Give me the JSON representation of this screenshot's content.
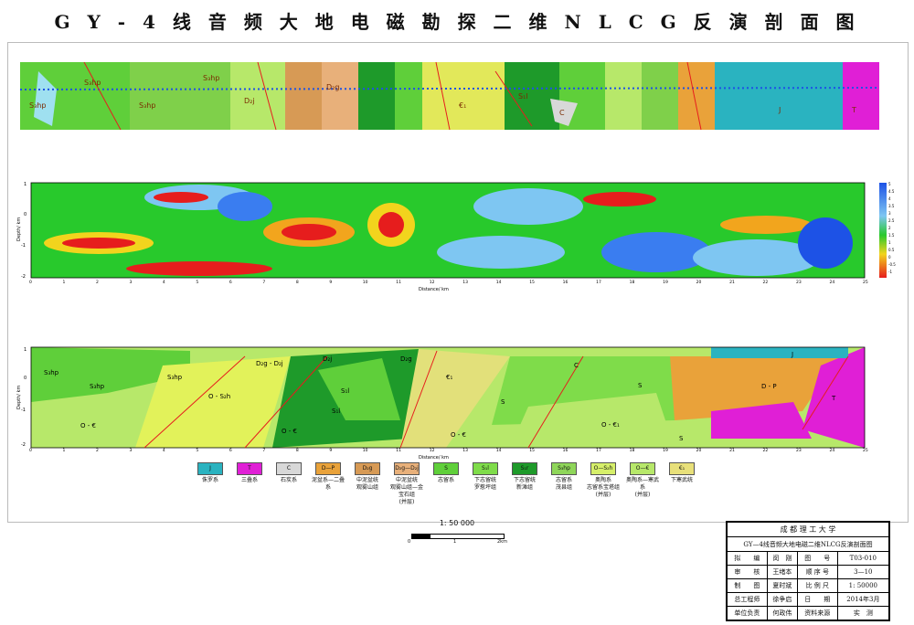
{
  "title": "G Y - 4 线 音 频 大 地 电 磁 勘 探 二 维 N L C G 反 演 剖 面 图",
  "colors": {
    "geo_green": "#5fcf3a",
    "geo_light": "#b7e86a",
    "geo_yellow": "#e2f25a",
    "geo_dark": "#1e9a2a",
    "geo_orange": "#e9a23a",
    "geo_magenta": "#e01fd6",
    "geo_teal": "#2ab3c0",
    "rho_red": "#e61d1d",
    "rho_blue": "#1d52e6"
  },
  "top_map": {
    "unit_labels": [
      "S₃hp",
      "S₃hp",
      "S₃hp",
      "S₃hp",
      "D₂j",
      "D₂g",
      "C",
      "€₁",
      "S₁l",
      "J",
      "T"
    ]
  },
  "inversion": {
    "y_ticks": [
      "1",
      "0",
      "-1",
      "-2"
    ],
    "y_label": "Depth/ km",
    "x_ticks": [
      "0",
      "1",
      "2",
      "3",
      "4",
      "5",
      "6",
      "7",
      "8",
      "9",
      "10",
      "11",
      "12",
      "13",
      "14",
      "15",
      "16",
      "17",
      "18",
      "19",
      "20",
      "21",
      "22",
      "23",
      "24",
      "25"
    ],
    "x_label": "Distance/ km",
    "colorbar_labels": [
      "5",
      "4.5",
      "4",
      "3.5",
      "3",
      "2.5",
      "2",
      "1.5",
      "1",
      "0.5",
      "0",
      "-0.5",
      "-1"
    ]
  },
  "geology": {
    "y_ticks": [
      "1",
      "0",
      "-1",
      "-2"
    ],
    "y_label": "Depth/ km",
    "x_ticks": [
      "0",
      "1",
      "2",
      "3",
      "4",
      "5",
      "6",
      "7",
      "8",
      "9",
      "10",
      "11",
      "12",
      "13",
      "14",
      "15",
      "16",
      "17",
      "18",
      "19",
      "20",
      "21",
      "22",
      "23",
      "24",
      "25"
    ],
    "x_label": "Distance/ km",
    "unit_labels": [
      "S₃hp",
      "S₃hp",
      "S₃hp",
      "O - S₂h",
      "O - €",
      "O - €",
      "D₂g - D₂j",
      "D₂j",
      "D₂g",
      "S₁l",
      "S₁l",
      "€₁",
      "S",
      "O - €",
      "C",
      "S",
      "O - €₁",
      "S",
      "D - P",
      "J",
      "T"
    ]
  },
  "legend": [
    {
      "code": "J",
      "label": "侏罗系",
      "color": "#2ab3c0"
    },
    {
      "code": "T",
      "label": "三叠系",
      "color": "#e01fd6"
    },
    {
      "code": "C",
      "label": "石炭系",
      "color": "#d8d8d8"
    },
    {
      "code": "D—P",
      "label": "泥盆系—二叠系",
      "color": "#e9a23a"
    },
    {
      "code": "D₂g",
      "label": "中泥盆统\n观雾山组",
      "color": "#d79a55"
    },
    {
      "code": "D₂g—D₂j",
      "label": "中泥盆统\n观雾山组—金宝石组\n(并层)",
      "color": "#e8b07a"
    },
    {
      "code": "S",
      "label": "志留系",
      "color": "#5fcf3a"
    },
    {
      "code": "S₁l",
      "label": "下志留统\n罗惹坪组",
      "color": "#7fdc4a"
    },
    {
      "code": "S₁r",
      "label": "下志留统\n新滩组",
      "color": "#1e9a2a"
    },
    {
      "code": "S₃hp",
      "label": "志留系\n茂县组",
      "color": "#8fd65a"
    },
    {
      "code": "O—S₂h",
      "label": "奥陶系\n志留系宝塔组\n(并层)",
      "color": "#d6ef6a"
    },
    {
      "code": "O—€",
      "label": "奥陶系—寒武系\n(并层)",
      "color": "#b7e86a"
    },
    {
      "code": "€₁",
      "label": "下寒武统",
      "color": "#e8e07a"
    }
  ],
  "scale": {
    "text": "1: 50 000",
    "labels": [
      "0",
      "1",
      "2km"
    ]
  },
  "title_block": {
    "org": "成 都 理 工 大 学",
    "map_name": "GY—4线音频大地电磁二维NLCG反演剖面图",
    "rows": [
      [
        "拟　　编",
        "闵　刚",
        "图　　号",
        "T03-010"
      ],
      [
        "审　　核",
        "王绪本",
        "顺 序 号",
        "3—10"
      ],
      [
        "制　　图",
        "夏时斌",
        "比 例 尺",
        "1: 50000"
      ],
      [
        "总工程师",
        "徐争启",
        "日　　期",
        "2014年3月"
      ],
      [
        "单位负责",
        "何政伟",
        "资料来源",
        "实　测"
      ]
    ]
  }
}
